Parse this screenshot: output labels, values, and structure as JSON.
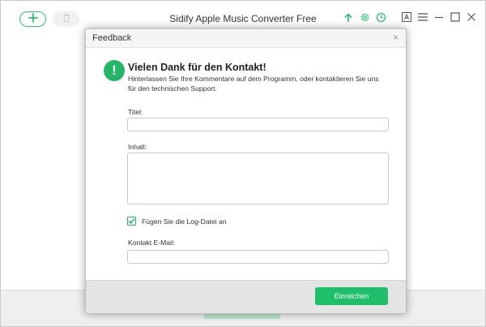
{
  "app": {
    "title": "Sidify Apple Music Converter Free"
  },
  "dialog": {
    "title": "Feedback",
    "close_glyph": "×",
    "info_glyph": "!",
    "heading": "Vielen Dank für den Kontakt!",
    "subtext": "Hinterlassen Sie Ihre Kommentare auf dem Programm, oder kontaktieren Sie uns für den technischen Support.",
    "title_label": "Titel:",
    "title_value": "",
    "content_label": "Inhalt:",
    "content_value": "",
    "log_checkbox_label": "Fügen Sie die Log-Datei an",
    "log_checked": true,
    "email_label": "Kontakt E-Mail:",
    "email_value": "",
    "submit_label": "Einreichen"
  },
  "colors": {
    "accent": "#24b667",
    "button": "#1fbf6a"
  },
  "icons": {
    "toolbar": [
      "add-icon",
      "trash-icon",
      "upload-icon",
      "gear-icon",
      "clock-icon",
      "text-icon",
      "menu-icon",
      "minimize-icon",
      "maximize-icon",
      "close-icon"
    ]
  }
}
